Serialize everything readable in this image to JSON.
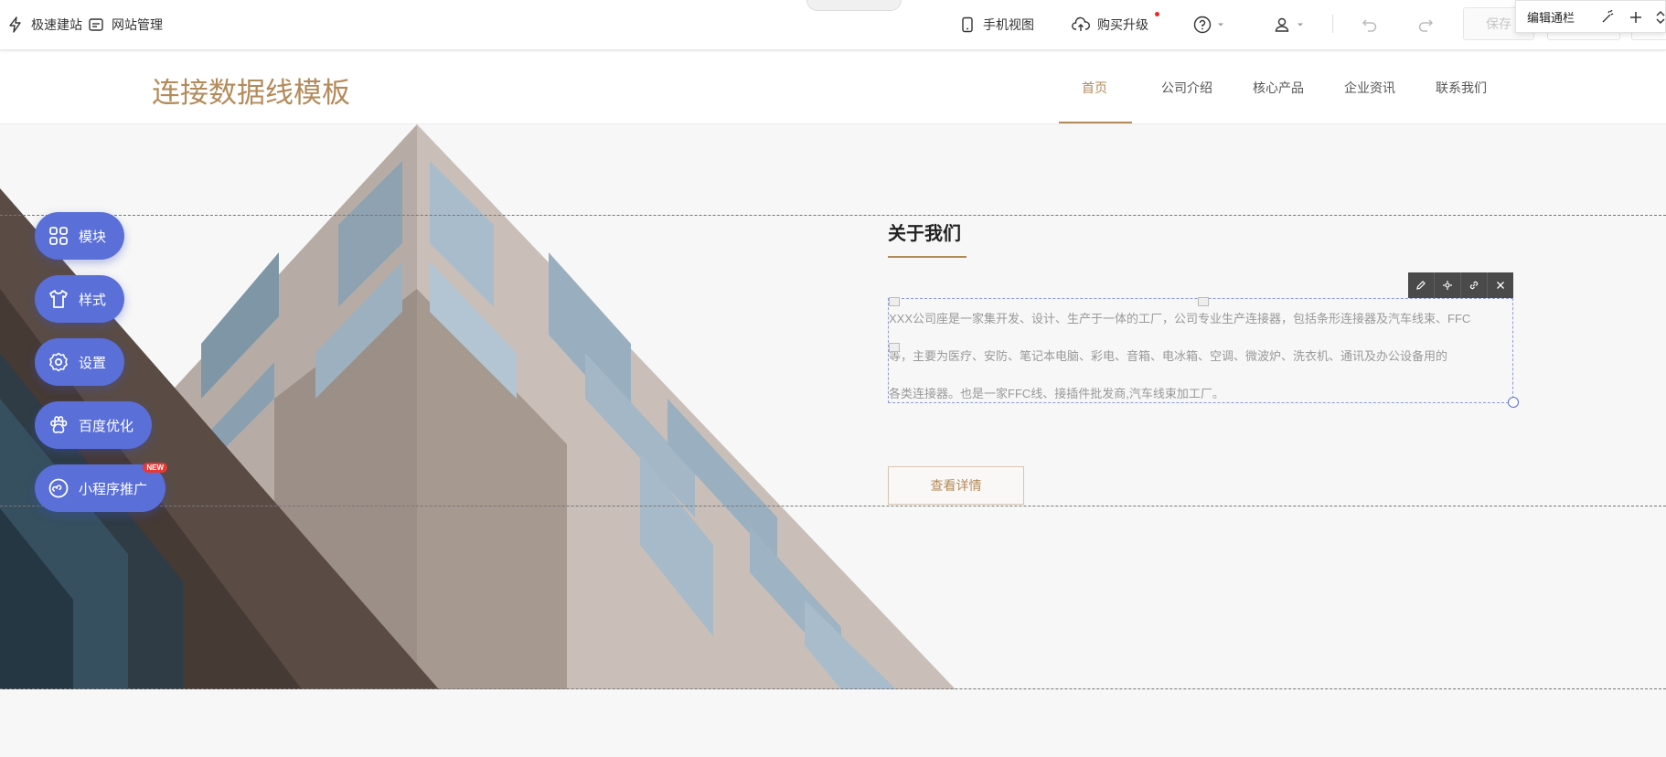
{
  "toolbar": {
    "quick_build": "极速建站",
    "site_manage": "网站管理",
    "mobile_view": "手机视图",
    "buy_upgrade": "购买升级",
    "save": "保存",
    "collapse_glyph": "⌃"
  },
  "edit_panel": {
    "label": "编辑通栏"
  },
  "site": {
    "title": "连接数据线模板",
    "nav": [
      "首页",
      "公司介绍",
      "核心产品",
      "企业资讯",
      "联系我们"
    ]
  },
  "about": {
    "title": "关于我们",
    "lines": [
      "XXX公司座是一家集开发、设计、生产于一体的工厂，公司专业生产连接器，包括条形连接器及汽车线束、FFC",
      "等，主要为医疗、安防、笔记本电脑、彩电、音箱、电冰箱、空调、微波炉、洗衣机、通讯及办公设备用的",
      "各类连接器。也是一家FFC线、接插件批发商,汽车线束加工厂。"
    ],
    "detail_button": "查看详情"
  },
  "side_menu": {
    "module": "模块",
    "style": "样式",
    "settings": "设置",
    "baidu_seo": "百度优化",
    "mini_program": "小程序推广",
    "new_badge": "NEW"
  },
  "colors": {
    "brand": "#b38a5a",
    "side_menu": "#5a6fd8",
    "edit_toolbar": "#4a4a4a"
  }
}
